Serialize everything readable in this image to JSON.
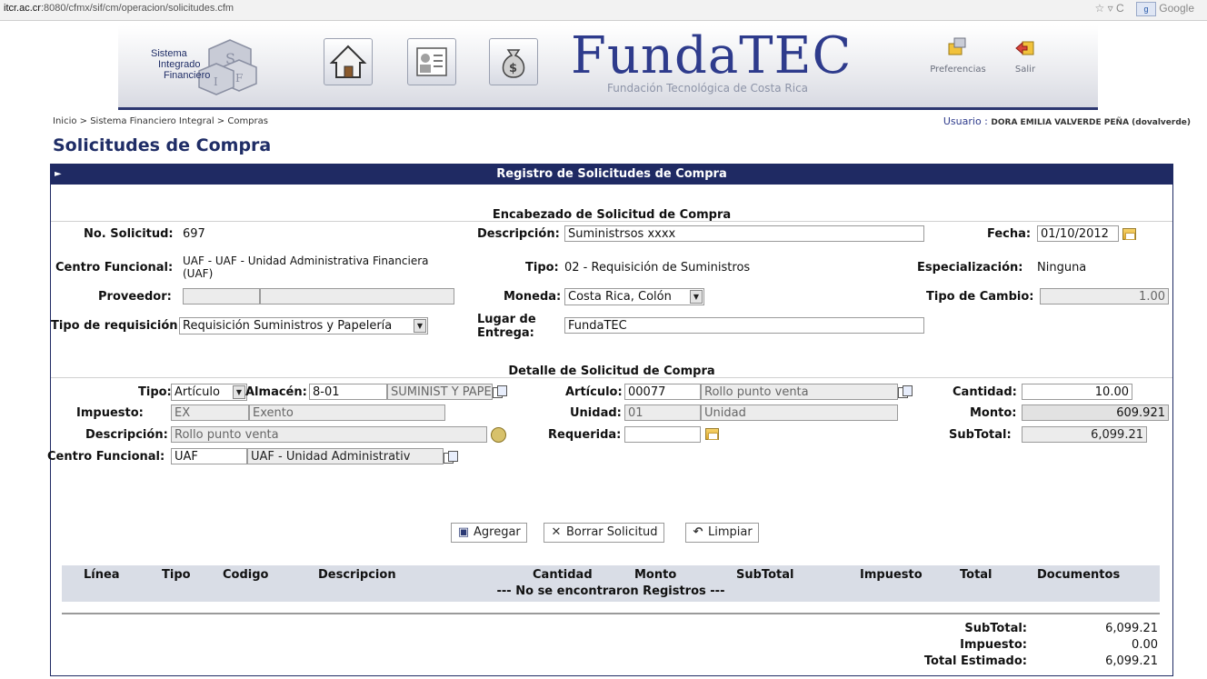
{
  "browser": {
    "url_host": "itcr.ac.cr",
    "url_path": ":8080/cfmx/sif/cm/operacion/solicitudes.cfm",
    "search_engine": "Google"
  },
  "banner": {
    "logo_lines": [
      "Sistema",
      "Integrado",
      "Financiero"
    ],
    "title": "FundaTEC",
    "subtitle": "Fundación Tecnológica de Costa Rica",
    "preferencias": "Preferencias",
    "salir": "Salir"
  },
  "breadcrumb": "Inicio > Sistema Financiero Integral > Compras",
  "usuario": {
    "label": "Usuario :",
    "name": "DORA EMILIA VALVERDE PEÑA (dovalverde)"
  },
  "page_title": "Solicitudes de Compra",
  "panel": {
    "title": "Registro de Solicitudes de Compra",
    "header_section": "Encabezado de Solicitud de Compra",
    "detail_section": "Detalle de Solicitud de Compra"
  },
  "header": {
    "no_solicitud_label": "No. Solicitud:",
    "no_solicitud": "697",
    "descripcion_label": "Descripción:",
    "descripcion": "Suministrsos xxxx",
    "fecha_label": "Fecha:",
    "fecha": "01/10/2012",
    "centro_label": "Centro Funcional:",
    "centro_line1": "UAF - UAF - Unidad Administrativa Financiera",
    "centro_line2": "(UAF)",
    "tipo_label": "Tipo:",
    "tipo": "02 - Requisición de Suministros",
    "especializacion_label": "Especialización:",
    "especializacion": "Ninguna",
    "proveedor_label": "Proveedor:",
    "moneda_label": "Moneda:",
    "moneda": "Costa Rica, Colón",
    "tipo_cambio_label": "Tipo de Cambio:",
    "tipo_cambio": "1.00",
    "tipo_requisicion_label": "Tipo de requisición",
    "tipo_requisicion": "Requisición Suministros y Papelería",
    "lugar_label_1": "Lugar de",
    "lugar_label_2": "Entrega:",
    "lugar": "FundaTEC"
  },
  "detail": {
    "tipo_label": "Tipo:",
    "tipo": "Artículo",
    "almacen_label": "Almacén:",
    "almacen_code": "8-01",
    "almacen_name": "SUMINIST Y PAPE",
    "articulo_label": "Artículo:",
    "articulo_code": "00077",
    "articulo_name": "Rollo punto venta",
    "cantidad_label": "Cantidad:",
    "cantidad": "10.00",
    "impuesto_label": "Impuesto:",
    "impuesto_code": "EX",
    "impuesto_name": "Exento",
    "unidad_label": "Unidad:",
    "unidad_code": "01",
    "unidad_name": "Unidad",
    "monto_label": "Monto:",
    "monto": "609.921",
    "descripcion_label": "Descripción:",
    "descripcion": "Rollo punto venta",
    "requerida_label": "Requerida:",
    "requerida": "",
    "subtotal_label": "SubTotal:",
    "subtotal": "6,099.21",
    "centro_label": "Centro Funcional:",
    "centro_code": "UAF",
    "centro_name": "UAF      - Unidad Administrativ"
  },
  "buttons": {
    "agregar": "Agregar",
    "borrar": "Borrar Solicitud",
    "limpiar": "Limpiar"
  },
  "grid": {
    "columns": [
      "Línea",
      "Tipo",
      "Codigo",
      "Descripcion",
      "Cantidad",
      "Monto",
      "SubTotal",
      "Impuesto",
      "Total",
      "Documentos"
    ],
    "empty_message": "--- No se encontraron Registros ---"
  },
  "totals": [
    {
      "label": "SubTotal:",
      "value": "6,099.21"
    },
    {
      "label": "Impuesto:",
      "value": "0.00"
    },
    {
      "label": "Total Estimado:",
      "value": "6,099.21"
    }
  ],
  "colors": {
    "primary": "#1f2a63",
    "title_blue": "#2e3b8c",
    "grid_header": "#d9dde6"
  }
}
